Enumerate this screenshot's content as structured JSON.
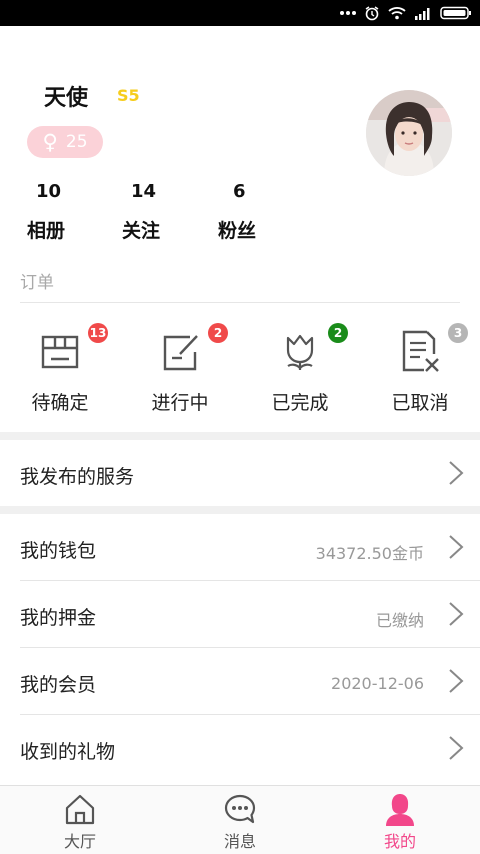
{
  "profile": {
    "name": "天使",
    "level": "S5",
    "gender_symbol": "♀",
    "age": "25",
    "stats": [
      {
        "value": "10",
        "label": "相册"
      },
      {
        "value": "14",
        "label": "关注"
      },
      {
        "value": "6",
        "label": "粉丝"
      }
    ]
  },
  "orders": {
    "title": "订单",
    "items": [
      {
        "label": "待确定",
        "count": "13",
        "icon": "box-icon",
        "badge_color": "#f04a4a"
      },
      {
        "label": "进行中",
        "count": "2",
        "icon": "edit-icon",
        "badge_color": "#f04a4a"
      },
      {
        "label": "已完成",
        "count": "2",
        "icon": "tulip-icon",
        "badge_color": "#1a8c1a"
      },
      {
        "label": "已取消",
        "count": "3",
        "icon": "cancel-doc-icon",
        "badge_color": "#b5b5b5"
      }
    ]
  },
  "menu": {
    "services": {
      "label": "我发布的服务",
      "value": ""
    },
    "wallet": {
      "label": "我的钱包",
      "value": "34372.50金币"
    },
    "deposit": {
      "label": "我的押金",
      "value": "已缴纳"
    },
    "membership": {
      "label": "我的会员",
      "value": "2020-12-06"
    },
    "gifts": {
      "label": "收到的礼物",
      "value": ""
    }
  },
  "tabs": [
    {
      "label": "大厅",
      "icon": "home-icon"
    },
    {
      "label": "消息",
      "icon": "message-icon"
    },
    {
      "label": "我的",
      "icon": "profile-icon",
      "active": true
    }
  ],
  "colors": {
    "accent": "#f2478a",
    "level": "#f6cd1d",
    "gender_badge": "#fbd2d8"
  }
}
